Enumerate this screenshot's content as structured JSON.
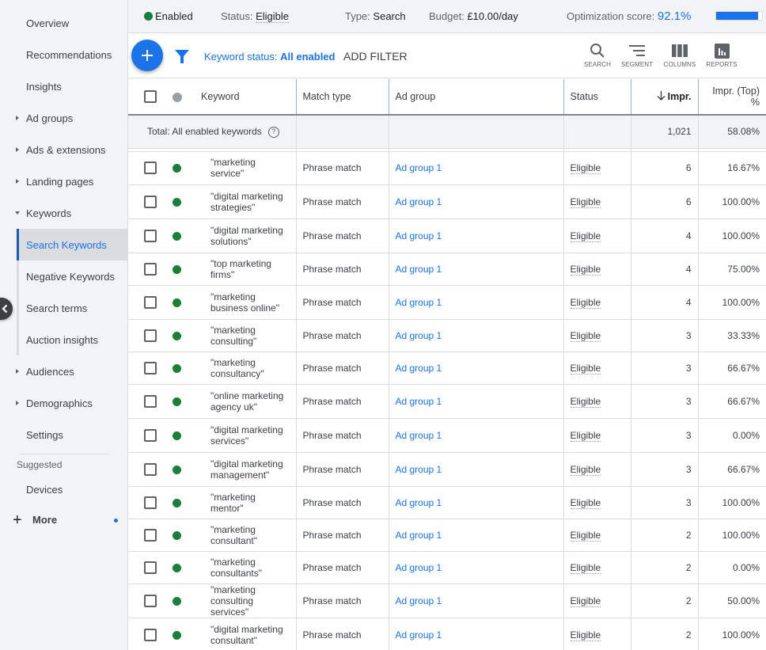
{
  "sidebar": {
    "items": [
      {
        "label": "Overview",
        "expandable": false
      },
      {
        "label": "Recommendations",
        "expandable": false
      },
      {
        "label": "Insights",
        "expandable": false
      },
      {
        "label": "Ad groups",
        "expandable": true
      },
      {
        "label": "Ads & extensions",
        "expandable": true
      },
      {
        "label": "Landing pages",
        "expandable": true
      },
      {
        "label": "Keywords",
        "expandable": true,
        "expanded": true
      }
    ],
    "keyword_subitems": [
      {
        "label": "Search Keywords",
        "active": true
      },
      {
        "label": "Negative Keywords"
      },
      {
        "label": "Search terms"
      },
      {
        "label": "Auction insights"
      }
    ],
    "items_after": [
      {
        "label": "Audiences",
        "expandable": true
      },
      {
        "label": "Demographics",
        "expandable": true
      },
      {
        "label": "Settings",
        "expandable": false
      }
    ],
    "suggested_label": "Suggested",
    "suggested_items": [
      {
        "label": "Devices"
      }
    ],
    "more_label": "More",
    "more_icon": "plus-icon",
    "collapse_icon": "chevron-left-icon"
  },
  "statusbar": {
    "enabled_label": "Enabled",
    "status_label": "Status:",
    "status_value": "Eligible",
    "type_label": "Type:",
    "type_value": "Search",
    "budget_label": "Budget:",
    "budget_value": "£10.00/day",
    "opt_label": "Optimization score:",
    "opt_value": "92.1%",
    "opt_fraction": 0.921,
    "enabled_color": "#188038"
  },
  "toolbar": {
    "add_icon": "plus-icon",
    "filter_icon": "filter-icon",
    "keyword_status_label": "Keyword status:",
    "keyword_status_value": "All enabled",
    "add_filter_label": "ADD FILTER",
    "tools": [
      {
        "label": "SEARCH",
        "icon": "search-icon"
      },
      {
        "label": "SEGMENT",
        "icon": "segment-icon"
      },
      {
        "label": "COLUMNS",
        "icon": "columns-icon"
      },
      {
        "label": "REPORTS",
        "icon": "reports-icon"
      }
    ]
  },
  "table": {
    "headers": {
      "keyword": "Keyword",
      "match_type": "Match type",
      "ad_group": "Ad group",
      "status": "Status",
      "impr": "Impr.",
      "impr_top_line1": "Impr. (Top)",
      "impr_top_line2": "%"
    },
    "sort_icon": "arrow-down-icon",
    "total": {
      "label": "Total: All enabled keywords",
      "impr": "1,021",
      "impr_top": "58.08%"
    },
    "rows": [
      {
        "keyword": "\"marketing service\"",
        "match_type": "Phrase match",
        "ad_group": "Ad group 1",
        "status": "Eligible",
        "impr": "6",
        "impr_top": "16.67%"
      },
      {
        "keyword": "\"digital marketing strategies\"",
        "match_type": "Phrase match",
        "ad_group": "Ad group 1",
        "status": "Eligible",
        "impr": "6",
        "impr_top": "100.00%"
      },
      {
        "keyword": "\"digital marketing solutions\"",
        "match_type": "Phrase match",
        "ad_group": "Ad group 1",
        "status": "Eligible",
        "impr": "4",
        "impr_top": "100.00%"
      },
      {
        "keyword": "\"top marketing firms\"",
        "match_type": "Phrase match",
        "ad_group": "Ad group 1",
        "status": "Eligible",
        "impr": "4",
        "impr_top": "75.00%"
      },
      {
        "keyword": "\"marketing business online\"",
        "match_type": "Phrase match",
        "ad_group": "Ad group 1",
        "status": "Eligible",
        "impr": "4",
        "impr_top": "100.00%"
      },
      {
        "keyword": "\"marketing consulting\"",
        "match_type": "Phrase match",
        "ad_group": "Ad group 1",
        "status": "Eligible",
        "impr": "3",
        "impr_top": "33.33%"
      },
      {
        "keyword": "\"marketing consultancy\"",
        "match_type": "Phrase match",
        "ad_group": "Ad group 1",
        "status": "Eligible",
        "impr": "3",
        "impr_top": "66.67%"
      },
      {
        "keyword": "\"online marketing agency uk\"",
        "match_type": "Phrase match",
        "ad_group": "Ad group 1",
        "status": "Eligible",
        "impr": "3",
        "impr_top": "66.67%"
      },
      {
        "keyword": "\"digital marketing services\"",
        "match_type": "Phrase match",
        "ad_group": "Ad group 1",
        "status": "Eligible",
        "impr": "3",
        "impr_top": "0.00%"
      },
      {
        "keyword": "\"digital marketing management\"",
        "match_type": "Phrase match",
        "ad_group": "Ad group 1",
        "status": "Eligible",
        "impr": "3",
        "impr_top": "66.67%"
      },
      {
        "keyword": "\"marketing mentor\"",
        "match_type": "Phrase match",
        "ad_group": "Ad group 1",
        "status": "Eligible",
        "impr": "3",
        "impr_top": "100.00%"
      },
      {
        "keyword": "\"marketing consultant\"",
        "match_type": "Phrase match",
        "ad_group": "Ad group 1",
        "status": "Eligible",
        "impr": "2",
        "impr_top": "100.00%"
      },
      {
        "keyword": "\"marketing consultants\"",
        "match_type": "Phrase match",
        "ad_group": "Ad group 1",
        "status": "Eligible",
        "impr": "2",
        "impr_top": "0.00%"
      },
      {
        "keyword": "\"marketing consulting services\"",
        "match_type": "Phrase match",
        "ad_group": "Ad group 1",
        "status": "Eligible",
        "impr": "2",
        "impr_top": "50.00%"
      },
      {
        "keyword": "\"digital marketing consultant\"",
        "match_type": "Phrase match",
        "ad_group": "Ad group 1",
        "status": "Eligible",
        "impr": "2",
        "impr_top": "100.00%"
      }
    ]
  },
  "colors": {
    "accent": "#1a73e8",
    "enabled_green": "#188038",
    "sidebar_bg": "#f1f3f4"
  }
}
